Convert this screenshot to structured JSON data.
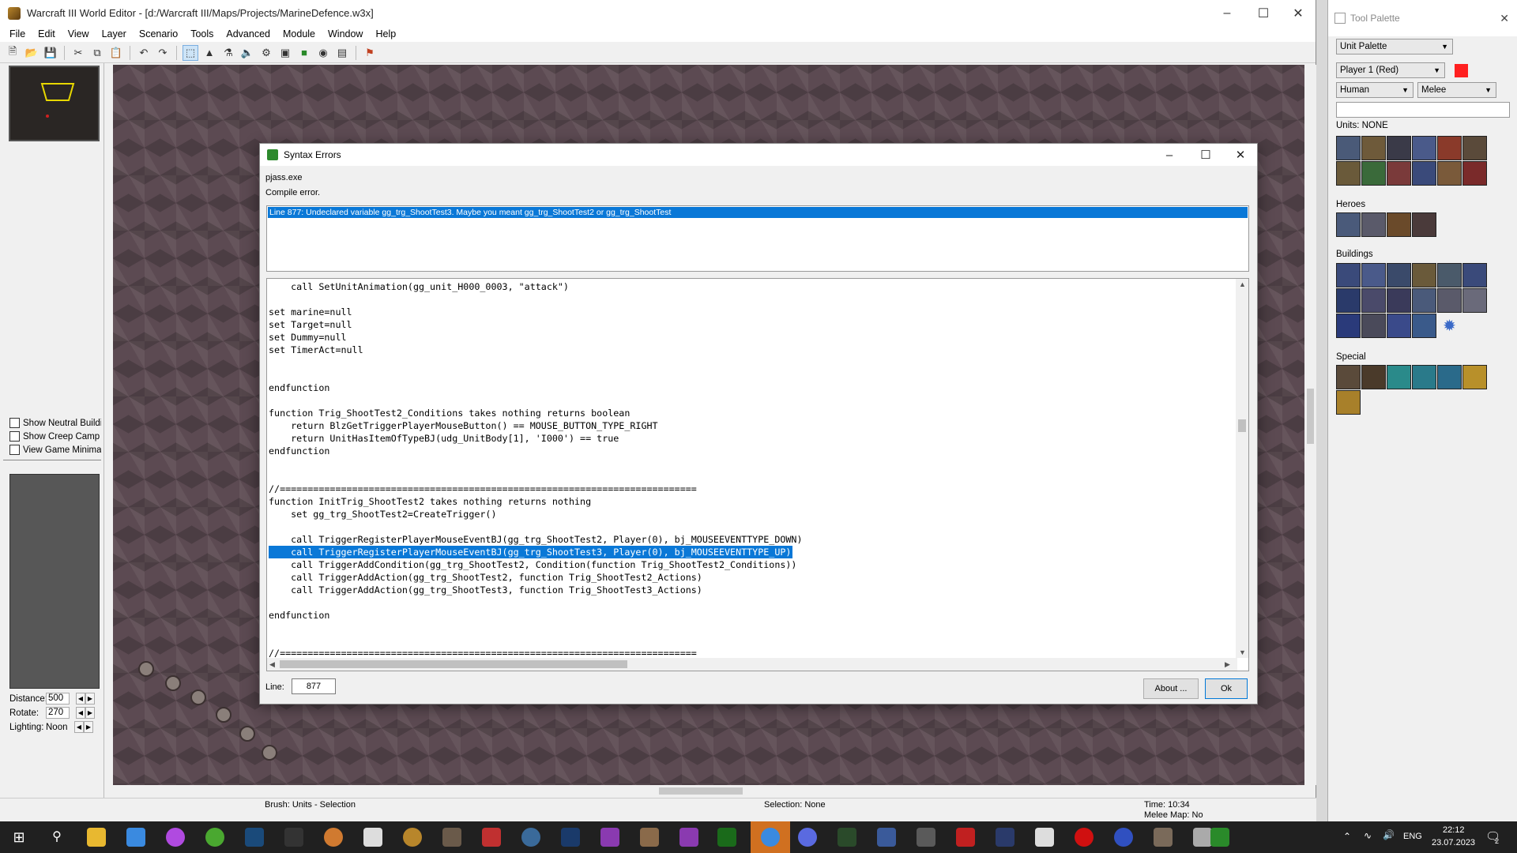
{
  "main_window": {
    "title": "Warcraft III World Editor - [d:/Warcraft III/Maps/Projects/MarineDefence.w3x]",
    "menu": [
      "File",
      "Edit",
      "View",
      "Layer",
      "Scenario",
      "Tools",
      "Advanced",
      "Module",
      "Window",
      "Help"
    ]
  },
  "left_panel": {
    "checkboxes": [
      "Show Neutral Buildin",
      "Show Creep Camp Ic",
      "View Game Minimap"
    ],
    "distance_label": "Distance:",
    "distance_value": "500",
    "rotate_label": "Rotate:",
    "rotate_value": "270",
    "lighting_label": "Lighting:",
    "lighting_value": "Noon"
  },
  "status_bar": {
    "brush": "Brush: Units - Selection",
    "selection": "Selection: None",
    "time": "Time: 10:34",
    "melee": "Melee Map: No"
  },
  "dialog": {
    "title": "Syntax Errors",
    "exe": "pjass.exe",
    "compile": "Compile error.",
    "error_line": "Line 877:  Undeclared variable gg_trg_ShootTest3. Maybe you meant gg_trg_ShootTest2 or gg_trg_ShootTest",
    "code": [
      "    call SetUnitAnimation(gg_unit_H000_0003, \"attack\")",
      "",
      "set marine=null",
      "set Target=null",
      "set Dummy=null",
      "set TimerAct=null",
      "",
      "",
      "endfunction",
      "",
      "function Trig_ShootTest2_Conditions takes nothing returns boolean",
      "    return BlzGetTriggerPlayerMouseButton() == MOUSE_BUTTON_TYPE_RIGHT",
      "    return UnitHasItemOfTypeBJ(udg_UnitBody[1], 'I000') == true",
      "endfunction",
      "",
      "",
      "//===========================================================================",
      "function InitTrig_ShootTest2 takes nothing returns nothing",
      "    set gg_trg_ShootTest2=CreateTrigger()",
      "",
      "    call TriggerRegisterPlayerMouseEventBJ(gg_trg_ShootTest2, Player(0), bj_MOUSEEVENTTYPE_DOWN)",
      "    call TriggerRegisterPlayerMouseEventBJ(gg_trg_ShootTest3, Player(0), bj_MOUSEEVENTTYPE_UP)",
      "    call TriggerAddCondition(gg_trg_ShootTest2, Condition(function Trig_ShootTest2_Conditions))",
      "    call TriggerAddAction(gg_trg_ShootTest2, function Trig_ShootTest2_Actions)",
      "    call TriggerAddAction(gg_trg_ShootTest3, function Trig_ShootTest3_Actions)",
      "",
      "endfunction",
      "",
      "",
      "//==========================================================================="
    ],
    "highlight_index": 21,
    "line_label": "Line:",
    "line_value": "877",
    "about_button": "About ...",
    "ok_button": "Ok"
  },
  "palette": {
    "title": "Tool Palette",
    "palette_select": "Unit Palette",
    "player_select": "Player 1 (Red)",
    "player_color": "#ff2020",
    "race_select": "Human",
    "mode_select": "Melee",
    "units_label": "Units: NONE",
    "heroes_label": "Heroes",
    "buildings_label": "Buildings",
    "special_label": "Special"
  },
  "taskbar": {
    "lang": "ENG",
    "time": "22:12",
    "date": "23.07.2023",
    "notif_count": "2"
  },
  "colors": {
    "selection_blue": "#0a78d7",
    "map_ground": "#5c4a52"
  }
}
